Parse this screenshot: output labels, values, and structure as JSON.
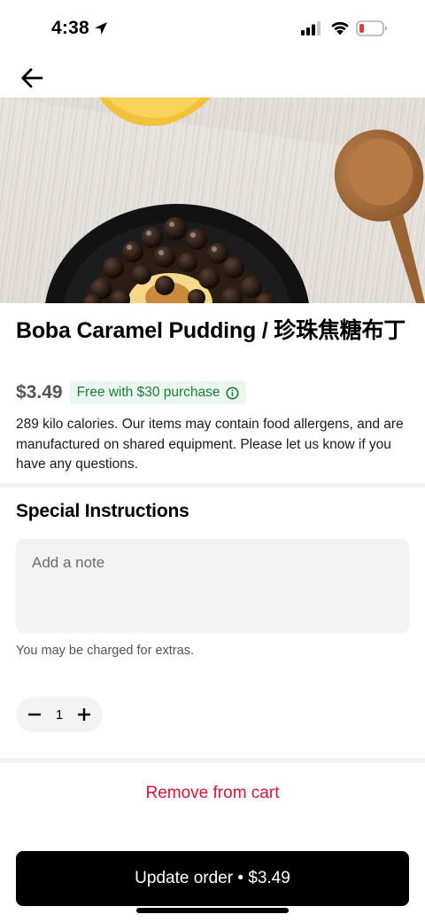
{
  "status_bar": {
    "time": "4:38",
    "location_icon": "location-arrow-icon",
    "signal_icon": "cellular-signal-icon",
    "wifi_icon": "wifi-icon",
    "battery_icon": "battery-low-icon",
    "battery_color": "#e53935"
  },
  "nav": {
    "back_icon": "arrow-left-icon"
  },
  "item": {
    "title": "Boba Caramel Pudding / 珍珠焦糖布丁",
    "price": "$3.49",
    "promo": "Free with $30 purchase",
    "promo_icon": "info-icon",
    "description": "289 kilo calories. Our items may contain food allergens, and are manufactured on shared equipment. Please let us know if you have any questions."
  },
  "special_instructions": {
    "title": "Special Instructions",
    "placeholder": "Add a note",
    "note_value": "",
    "charge_note": "You may be charged for extras."
  },
  "quantity": {
    "value": "1",
    "decrement_icon": "minus-icon",
    "increment_icon": "plus-icon"
  },
  "actions": {
    "remove_label": "Remove from cart",
    "update_label": "Update order • $3.49"
  },
  "colors": {
    "remove_red": "#de1135",
    "promo_green": "#1d7a3f",
    "promo_bg": "#eaf6ee",
    "primary_button": "#000000"
  }
}
